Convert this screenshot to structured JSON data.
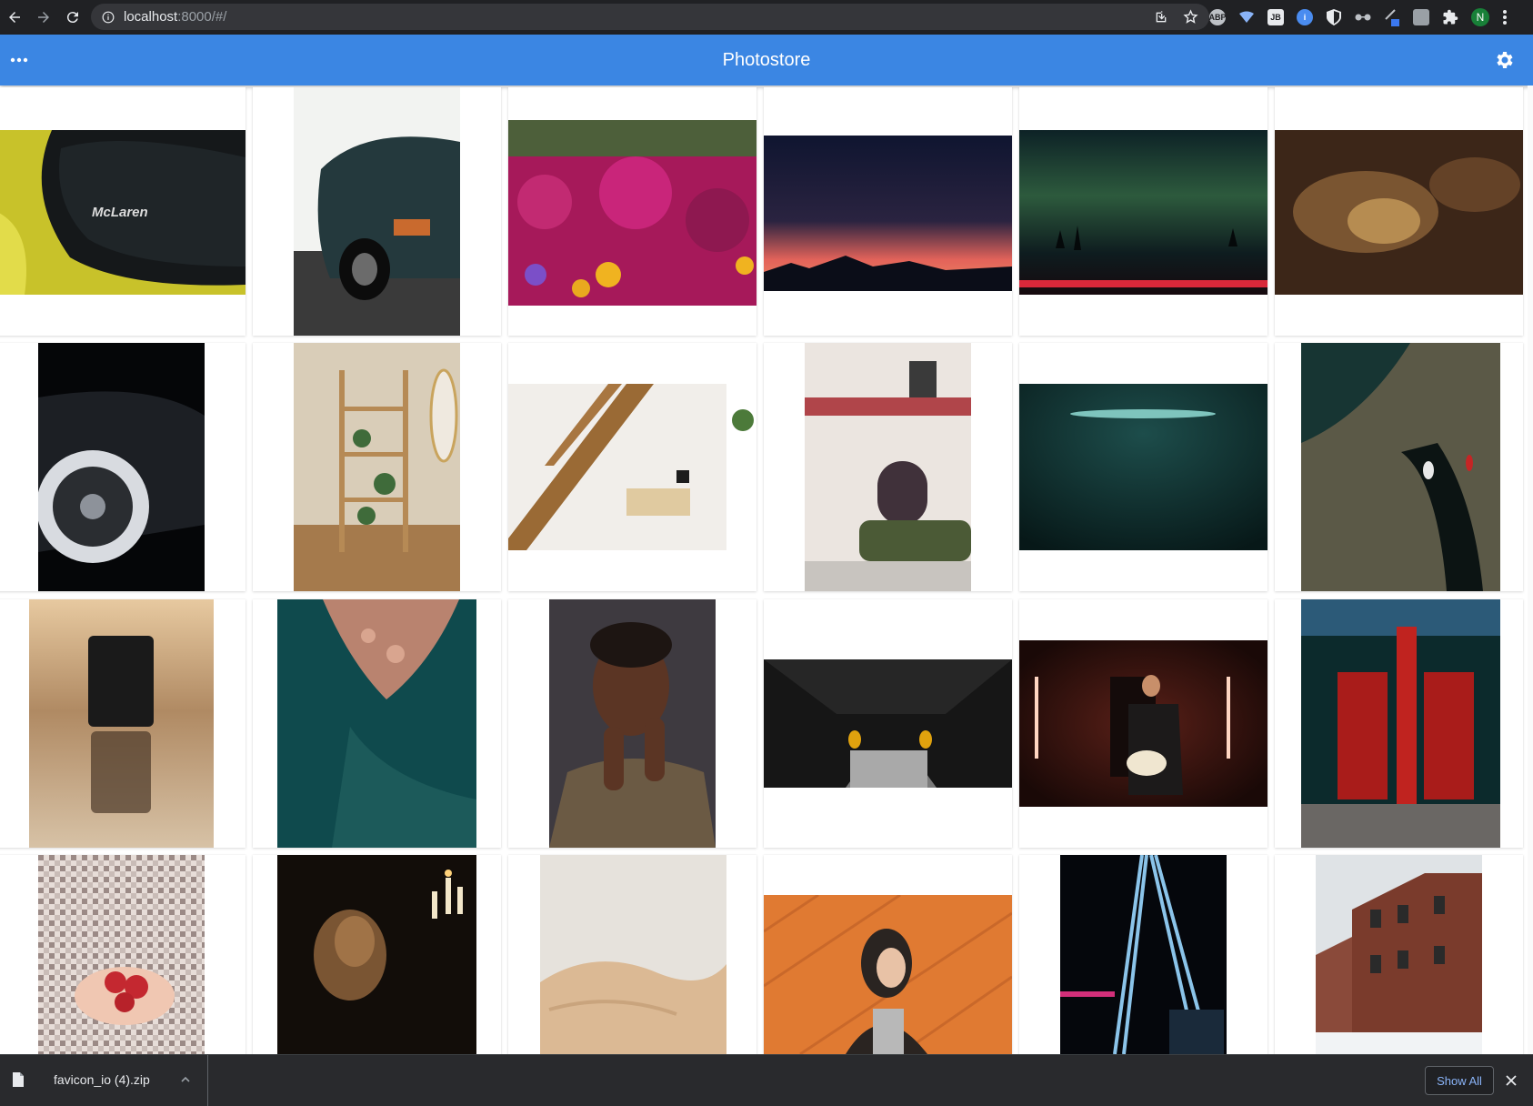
{
  "browser": {
    "url_host": "localhost",
    "url_rest": ":8000/#/",
    "profile_initial": "N"
  },
  "app": {
    "title": "Photostore"
  },
  "photos": [
    {
      "subject": "McLaren car detail",
      "colors": [
        "#c8c22a",
        "#16191b"
      ],
      "logo_text": "McLaren"
    },
    {
      "subject": "Teal vintage Porsche",
      "colors": [
        "#f2f3f1",
        "#23363a"
      ]
    },
    {
      "subject": "Magenta flower bush",
      "colors": [
        "#5b6e3a",
        "#b2195e"
      ]
    },
    {
      "subject": "Sunset mountain silhouette",
      "colors": [
        "#12162c",
        "#e2645c"
      ]
    },
    {
      "subject": "Aurora over trees",
      "colors": [
        "#0c1f22",
        "#d8283a"
      ]
    },
    {
      "subject": "Blurred bokeh amber",
      "colors": [
        "#3d2618",
        "#b8874a"
      ]
    },
    {
      "subject": "Black concept car wheel",
      "colors": [
        "#050608",
        "#9aa0a8"
      ]
    },
    {
      "subject": "Shelf with plants",
      "colors": [
        "#c9b28f",
        "#8c6a42"
      ]
    },
    {
      "subject": "Wooden stairs and desk",
      "colors": [
        "#f1eeea",
        "#9a6a35"
      ]
    },
    {
      "subject": "Storefront with traffic light",
      "colors": [
        "#eae4df",
        "#4b5a36"
      ]
    },
    {
      "subject": "Dark teal glow",
      "colors": [
        "#0d2a2a",
        "#5ea7a1"
      ]
    },
    {
      "subject": "Aerial coast with boat",
      "colors": [
        "#1f3b38",
        "#5c5a4a"
      ]
    },
    {
      "subject": "Camera lens reflection",
      "colors": [
        "#b08a63",
        "#1a1a1a"
      ]
    },
    {
      "subject": "Aerial turquoise rocks",
      "colors": [
        "#0f4a4d",
        "#c08f7c"
      ]
    },
    {
      "subject": "Portrait woman",
      "colors": [
        "#3e3a40",
        "#6a4430"
      ]
    },
    {
      "subject": "Looking down city",
      "colors": [
        "#161616",
        "#e0a20e"
      ]
    },
    {
      "subject": "Guitarist with neon",
      "colors": [
        "#210d0b",
        "#f25b45"
      ]
    },
    {
      "subject": "Red temple door",
      "colors": [
        "#0c2a2c",
        "#b8221e"
      ]
    },
    {
      "subject": "Hands with strawberries",
      "colors": [
        "#cfc5c0",
        "#c42830"
      ]
    },
    {
      "subject": "Woman by candlelight",
      "colors": [
        "#120d09",
        "#a07347"
      ]
    },
    {
      "subject": "Cream blanket",
      "colors": [
        "#e6e2dc",
        "#dbb994"
      ]
    },
    {
      "subject": "Woman orange wall",
      "colors": [
        "#e07a32",
        "#2a2421"
      ]
    },
    {
      "subject": "Neon light trails",
      "colors": [
        "#05070c",
        "#8bc4ea"
      ]
    },
    {
      "subject": "Brick buildings in snow",
      "colors": [
        "#dfe3e6",
        "#7a3b2c"
      ]
    }
  ],
  "download": {
    "filename": "favicon_io (4).zip",
    "show_all_label": "Show All"
  },
  "icons": {
    "back": "arrow-back-icon",
    "forward": "arrow-forward-icon",
    "reload": "reload-icon",
    "info": "info-icon",
    "menu": "more-horiz-icon",
    "settings": "gear-icon",
    "file": "file-icon",
    "chevron": "chevron-up-icon",
    "close": "close-icon"
  },
  "colors": {
    "appbar": "#3b86e3",
    "chrome": "#202124",
    "shelf": "#292a2d",
    "link": "#8ab4f8"
  }
}
